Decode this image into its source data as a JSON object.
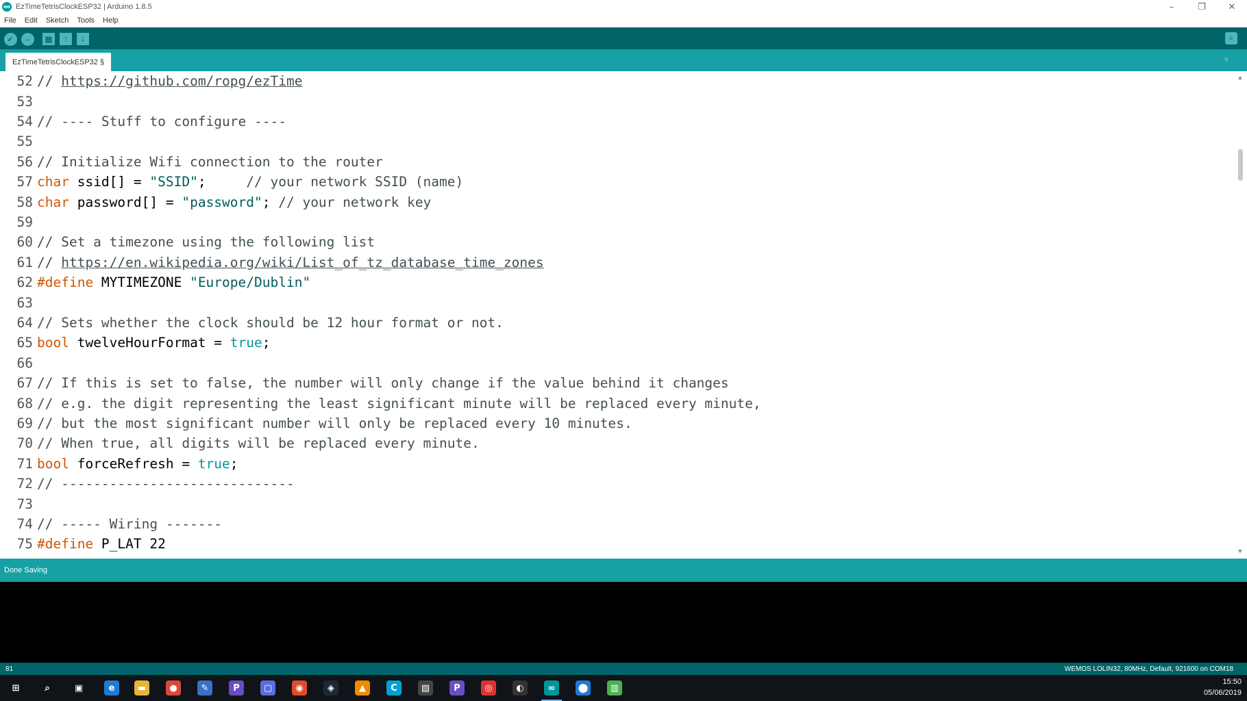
{
  "window": {
    "title": "EzTimeTetrisClockESP32 | Arduino 1.8.5",
    "logo_text": "oo",
    "controls": [
      "–",
      "❐",
      "✕"
    ]
  },
  "menu": [
    "File",
    "Edit",
    "Sketch",
    "Tools",
    "Help"
  ],
  "toolbar": {
    "verify_icon": "✓",
    "upload_icon": "→",
    "new_icon": "▤",
    "open_icon": "↑",
    "save_icon": "↓",
    "serial_icon": "⌕"
  },
  "tab": {
    "label": "EzTimeTetrisClockESP32 §",
    "menu_icon": "▼"
  },
  "code_lines": [
    {
      "n": "52",
      "parts": [
        [
          "c",
          "// "
        ],
        [
          "u",
          "https://github.com/ropg/ezTime"
        ]
      ]
    },
    {
      "n": "53",
      "parts": []
    },
    {
      "n": "54",
      "parts": [
        [
          "c",
          "// ---- Stuff to configure ----"
        ]
      ]
    },
    {
      "n": "55",
      "parts": []
    },
    {
      "n": "56",
      "parts": [
        [
          "c",
          "// Initialize Wifi connection to the router"
        ]
      ]
    },
    {
      "n": "57",
      "parts": [
        [
          "k",
          "char"
        ],
        [
          "p",
          " ssid[] = "
        ],
        [
          "s",
          "\"SSID\""
        ],
        [
          "p",
          ";     "
        ],
        [
          "c",
          "// your network SSID (name)"
        ]
      ]
    },
    {
      "n": "58",
      "parts": [
        [
          "k",
          "char"
        ],
        [
          "p",
          " password[] = "
        ],
        [
          "s",
          "\"password\""
        ],
        [
          "p",
          "; "
        ],
        [
          "c",
          "// your network key"
        ]
      ]
    },
    {
      "n": "59",
      "parts": []
    },
    {
      "n": "60",
      "parts": [
        [
          "c",
          "// Set a timezone using the following list"
        ]
      ]
    },
    {
      "n": "61",
      "parts": [
        [
          "c",
          "// "
        ],
        [
          "u",
          "https://en.wikipedia.org/wiki/List_of_tz_database_time_zones"
        ]
      ]
    },
    {
      "n": "62",
      "parts": [
        [
          "k",
          "#define"
        ],
        [
          "p",
          " MYTIMEZONE "
        ],
        [
          "s",
          "\"Europe/Dublin\""
        ]
      ]
    },
    {
      "n": "63",
      "parts": []
    },
    {
      "n": "64",
      "parts": [
        [
          "c",
          "// Sets whether the clock should be 12 hour format or not."
        ]
      ]
    },
    {
      "n": "65",
      "parts": [
        [
          "k",
          "bool"
        ],
        [
          "p",
          " twelveHourFormat = "
        ],
        [
          "l",
          "true"
        ],
        [
          "p",
          ";"
        ]
      ]
    },
    {
      "n": "66",
      "parts": []
    },
    {
      "n": "67",
      "parts": [
        [
          "c",
          "// If this is set to false, the number will only change if the value behind it changes"
        ]
      ]
    },
    {
      "n": "68",
      "parts": [
        [
          "c",
          "// e.g. the digit representing the least significant minute will be replaced every minute,"
        ]
      ]
    },
    {
      "n": "69",
      "parts": [
        [
          "c",
          "// but the most significant number will only be replaced every 10 minutes."
        ]
      ]
    },
    {
      "n": "70",
      "parts": [
        [
          "c",
          "// When true, all digits will be replaced every minute."
        ]
      ]
    },
    {
      "n": "71",
      "parts": [
        [
          "k",
          "bool"
        ],
        [
          "p",
          " forceRefresh = "
        ],
        [
          "l",
          "true"
        ],
        [
          "p",
          ";"
        ]
      ]
    },
    {
      "n": "72",
      "parts": [
        [
          "c",
          "// -----------------------------"
        ]
      ]
    },
    {
      "n": "73",
      "parts": []
    },
    {
      "n": "74",
      "parts": [
        [
          "c",
          "// ----- Wiring -------"
        ]
      ]
    },
    {
      "n": "75",
      "parts": [
        [
          "k",
          "#define"
        ],
        [
          "p",
          " P_LAT 22"
        ]
      ]
    }
  ],
  "scroll": {
    "up_icon": "▲",
    "down_icon": "▼"
  },
  "status": {
    "message": "Done Saving"
  },
  "footer": {
    "line": "81",
    "board": "WEMOS LOLIN32, 80MHz, Default, 921600 on COM18"
  },
  "taskbar": {
    "apps": [
      {
        "name": "start-icon",
        "glyph": "⊞",
        "color": "transparent"
      },
      {
        "name": "search-icon",
        "glyph": "⌕",
        "color": "transparent"
      },
      {
        "name": "task-view-icon",
        "glyph": "▣",
        "color": "transparent"
      },
      {
        "name": "edge-icon",
        "glyph": "e",
        "color": "#1e7bd4"
      },
      {
        "name": "file-explorer-icon",
        "glyph": "▬",
        "color": "#e7b53a"
      },
      {
        "name": "chrome-icon",
        "glyph": "●",
        "color": "#d94a38"
      },
      {
        "name": "pen-tool-icon",
        "glyph": "✎",
        "color": "#3a6fc4"
      },
      {
        "name": "app-purple-icon",
        "glyph": "P",
        "color": "#6a4cc4"
      },
      {
        "name": "notification-app-icon",
        "glyph": "▢",
        "color": "#5b6de0"
      },
      {
        "name": "maps-pin-icon",
        "glyph": "◉",
        "color": "#e04a2a"
      },
      {
        "name": "steam-icon",
        "glyph": "◈",
        "color": "#1b2838"
      },
      {
        "name": "vlc-icon",
        "glyph": "▲",
        "color": "#f08a00"
      },
      {
        "name": "app-c-icon",
        "glyph": "C",
        "color": "#00a2d6"
      },
      {
        "name": "photos-icon",
        "glyph": "▨",
        "color": "#444"
      },
      {
        "name": "app-purple2-icon",
        "glyph": "P",
        "color": "#6a4cc4"
      },
      {
        "name": "app-q-icon",
        "glyph": "◎",
        "color": "#d33"
      },
      {
        "name": "obs-icon",
        "glyph": "◐",
        "color": "#333"
      },
      {
        "name": "arduino-icon",
        "glyph": "∞",
        "color": "#00979c"
      },
      {
        "name": "location-icon",
        "glyph": "⬤",
        "color": "#1e7bd4"
      },
      {
        "name": "chart-app-icon",
        "glyph": "▥",
        "color": "#4caf50"
      }
    ],
    "active_index": 17,
    "time": "15:50",
    "date": "05/06/2019"
  }
}
